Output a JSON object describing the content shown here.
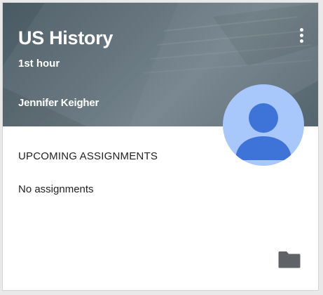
{
  "course": {
    "title": "US History",
    "section": "1st hour",
    "teacher": "Jennifer Keigher"
  },
  "upcoming": {
    "heading": "UPCOMING ASSIGNMENTS",
    "empty_text": "No assignments"
  },
  "icons": {
    "menu": "more-vert-icon",
    "avatar": "person-icon",
    "folder": "folder-icon"
  },
  "colors": {
    "banner": "#5d6d76",
    "avatar_background": "#a8c7fa",
    "avatar_person": "#3e74d8",
    "folder_icon": "#5f6368"
  }
}
